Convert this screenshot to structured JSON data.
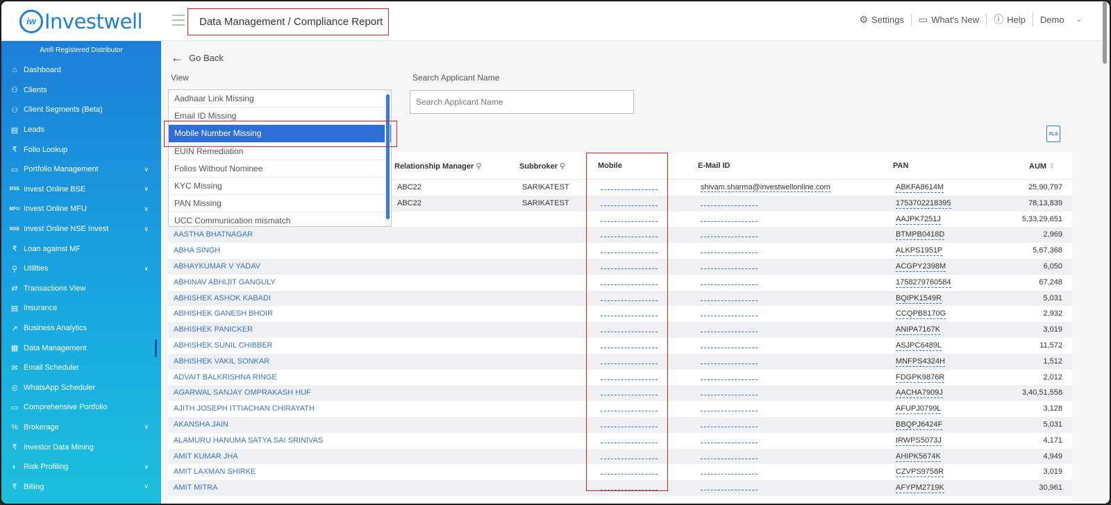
{
  "brand": {
    "logo_mark": "iw",
    "name": "Investwell"
  },
  "header": {
    "breadcrumb": "Data Management / Compliance Report",
    "settings": "Settings",
    "whats_new": "What's New",
    "help": "Help",
    "user": "Demo"
  },
  "sidebar": {
    "distributor": "Amfi Registered Distributor",
    "items": [
      {
        "label": "Dashboard",
        "icon": "home-icon",
        "glyph": "⌂",
        "expand": false
      },
      {
        "label": "Clients",
        "icon": "users-icon",
        "glyph": "⚇",
        "expand": false
      },
      {
        "label": "Client Segments (Beta)",
        "icon": "segments-icon",
        "glyph": "⚇",
        "expand": false
      },
      {
        "label": "Leads",
        "icon": "leads-icon",
        "glyph": "▤",
        "expand": false
      },
      {
        "label": "Folio Lookup",
        "icon": "rupee-icon",
        "glyph": "₹",
        "expand": false
      },
      {
        "label": "Portfolio Management",
        "icon": "briefcase-icon",
        "glyph": "▭",
        "expand": true
      },
      {
        "label": "Invest Online BSE",
        "icon": "bse-icon",
        "glyph": "BSE",
        "expand": true
      },
      {
        "label": "Invest Online MFU",
        "icon": "mfu-icon",
        "glyph": "MFU",
        "expand": true
      },
      {
        "label": "Invest Online NSE Invest",
        "icon": "nse-icon",
        "glyph": "NSE",
        "expand": true
      },
      {
        "label": "Loan against MF",
        "icon": "loan-icon",
        "glyph": "₹",
        "expand": false
      },
      {
        "label": "Utilities",
        "icon": "search-icon",
        "glyph": "⚲",
        "expand": true
      },
      {
        "label": "Transactions View",
        "icon": "transfer-icon",
        "glyph": "⇄",
        "expand": false
      },
      {
        "label": "Insurance",
        "icon": "insurance-icon",
        "glyph": "▤",
        "expand": false
      },
      {
        "label": "Business Analytics",
        "icon": "analytics-icon",
        "glyph": "↗",
        "expand": false
      },
      {
        "label": "Data Management",
        "icon": "database-icon",
        "glyph": "▦",
        "expand": false,
        "active": true
      },
      {
        "label": "Email Scheduler",
        "icon": "email-icon",
        "glyph": "✉",
        "expand": false
      },
      {
        "label": "WhatsApp Scheduler",
        "icon": "whatsapp-icon",
        "glyph": "◎",
        "expand": false
      },
      {
        "label": "Comprehensive Portfolio",
        "icon": "portfolio-icon",
        "glyph": "▭",
        "expand": false
      },
      {
        "label": "Brokerage",
        "icon": "percent-icon",
        "glyph": "%",
        "expand": true
      },
      {
        "label": "Investor Data Mining",
        "icon": "mining-icon",
        "glyph": "₹",
        "expand": false
      },
      {
        "label": "Risk Profiling",
        "icon": "risk-icon",
        "glyph": "◐",
        "expand": true
      },
      {
        "label": "Billing",
        "icon": "billing-icon",
        "glyph": "₹",
        "expand": true
      }
    ]
  },
  "main": {
    "go_back": "Go Back",
    "view_label": "View",
    "search_label": "Search Applicant Name",
    "search_placeholder": "Search Applicant Name",
    "xls": "XLS"
  },
  "view_options": [
    {
      "label": "Aadhaar Link Missing",
      "selected": false
    },
    {
      "label": "Email ID Missing",
      "selected": false
    },
    {
      "label": "Mobile Number Missing",
      "selected": true
    },
    {
      "label": "EUIN Remediation",
      "selected": false
    },
    {
      "label": "Folios Without Nominee",
      "selected": false
    },
    {
      "label": "KYC Missing",
      "selected": false
    },
    {
      "label": "PAN Missing",
      "selected": false
    },
    {
      "label": "UCC Communication mismatch",
      "selected": false
    }
  ],
  "table": {
    "headers": {
      "rm": "Relationship Manager",
      "subbroker": "Subbroker",
      "mobile": "Mobile",
      "email": "E-Mail ID",
      "pan": "PAN",
      "aum": "AUM"
    },
    "rows": [
      {
        "name": "",
        "rm": "ABC22",
        "sub": "SARIKATEST",
        "email": "shivam.sharma@investwellonline.com",
        "pan": "ABKFA8614M",
        "aum": "25,90,797"
      },
      {
        "name": "",
        "rm": "ABC22",
        "sub": "SARIKATEST",
        "email": "",
        "pan": "1753702218395",
        "aum": "78,13,839"
      },
      {
        "name": "",
        "rm": "",
        "sub": "",
        "email": "",
        "pan": "AAJPK7251J",
        "aum": "5,33,29,651"
      },
      {
        "name": "AASTHA BHATNAGAR",
        "rm": "",
        "sub": "",
        "email": "",
        "pan": "BTMPB0418D",
        "aum": "2,969"
      },
      {
        "name": "ABHA SINGH",
        "rm": "",
        "sub": "",
        "email": "",
        "pan": "ALKPS1951P",
        "aum": "5,67,368"
      },
      {
        "name": "ABHAYKUMAR V YADAV",
        "rm": "",
        "sub": "",
        "email": "",
        "pan": "ACGPY2398M",
        "aum": "6,050"
      },
      {
        "name": "ABHINAV ABHIJIT GANGULY",
        "rm": "",
        "sub": "",
        "email": "",
        "pan": "1758279760584",
        "aum": "67,248"
      },
      {
        "name": "ABHISHEK ASHOK KABADI",
        "rm": "",
        "sub": "",
        "email": "",
        "pan": "BQIPK1549R",
        "aum": "5,031"
      },
      {
        "name": "ABHISHEK GANESH BHOIR",
        "rm": "",
        "sub": "",
        "email": "",
        "pan": "CCQPB8170G",
        "aum": "2,932"
      },
      {
        "name": "ABHISHEK PANICKER",
        "rm": "",
        "sub": "",
        "email": "",
        "pan": "ANIPA7167K",
        "aum": "3,019"
      },
      {
        "name": "ABHISHEK SUNIL CHIBBER",
        "rm": "",
        "sub": "",
        "email": "",
        "pan": "ASJPC6489L",
        "aum": "11,572"
      },
      {
        "name": "ABHISHEK VAKIL SONKAR",
        "rm": "",
        "sub": "",
        "email": "",
        "pan": "MNFPS4324H",
        "aum": "1,512"
      },
      {
        "name": "ADVAIT BALKRISHNA RINGE",
        "rm": "",
        "sub": "",
        "email": "",
        "pan": "FDGPK9876R",
        "aum": "2,012"
      },
      {
        "name": "AGARWAL SANJAY OMPRAKASH HUF",
        "rm": "",
        "sub": "",
        "email": "",
        "pan": "AACHA7909J",
        "aum": "3,40,51,558"
      },
      {
        "name": "AJITH JOSEPH ITTIACHAN CHIRAYATH",
        "rm": "",
        "sub": "",
        "email": "",
        "pan": "AFUPJ0799L",
        "aum": "3,128"
      },
      {
        "name": "AKANSHA JAIN",
        "rm": "",
        "sub": "",
        "email": "",
        "pan": "BBQPJ6424F",
        "aum": "5,031"
      },
      {
        "name": "ALAMURU HANUMA SATYA SAI SRINIVAS",
        "rm": "",
        "sub": "",
        "email": "",
        "pan": "IRWPS5073J",
        "aum": "4,171"
      },
      {
        "name": "AMIT KUMAR JHA",
        "rm": "",
        "sub": "",
        "email": "",
        "pan": "AHIPK5674K",
        "aum": "4,949"
      },
      {
        "name": "AMIT LAXMAN SHIRKE",
        "rm": "",
        "sub": "",
        "email": "",
        "pan": "CZVPS9758R",
        "aum": "3,019"
      },
      {
        "name": "AMIT MITRA",
        "rm": "",
        "sub": "",
        "email": "",
        "pan": "AFYPM2719K",
        "aum": "30,961"
      }
    ]
  },
  "colors": {
    "accent": "#1e7fd8",
    "highlight": "#e01e1e",
    "selected": "#2d6fd6",
    "link": "#3a73c4"
  }
}
